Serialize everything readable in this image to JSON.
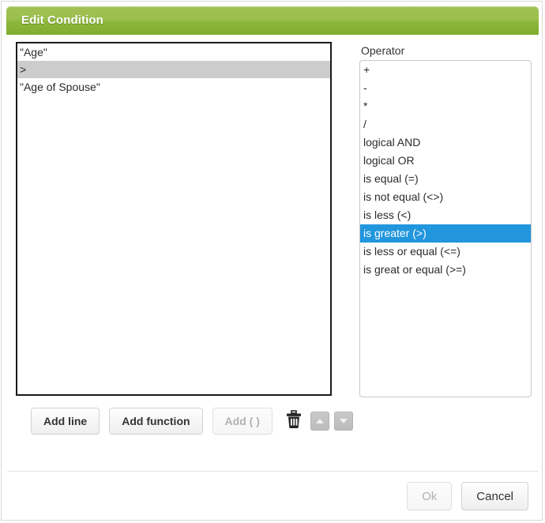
{
  "window": {
    "title": "Edit Condition",
    "accent_green": "#8cb63c",
    "selection_blue": "#2196dd",
    "row_selection_grey": "#cccccc"
  },
  "expression_list": {
    "name": "expression-list",
    "items": [
      {
        "text": "\"Age\"",
        "selected": false
      },
      {
        "text": ">",
        "selected": true
      },
      {
        "text": "\"Age of Spouse\"",
        "selected": false
      }
    ]
  },
  "operator_panel": {
    "label": "Operator",
    "items": [
      {
        "text": "+",
        "selected": false
      },
      {
        "text": "-",
        "selected": false
      },
      {
        "text": "*",
        "selected": false
      },
      {
        "text": "/",
        "selected": false
      },
      {
        "text": "logical AND",
        "selected": false
      },
      {
        "text": "logical OR",
        "selected": false
      },
      {
        "text": "is equal (=)",
        "selected": false
      },
      {
        "text": "is not equal (<>)",
        "selected": false
      },
      {
        "text": "is less (<)",
        "selected": false
      },
      {
        "text": "is greater (>)",
        "selected": true
      },
      {
        "text": "is less or equal (<=)",
        "selected": false
      },
      {
        "text": "is great or equal (>=)",
        "selected": false
      }
    ]
  },
  "toolbar": {
    "add_line_label": "Add line",
    "add_function_label": "Add function",
    "add_parens_label": "Add ( )",
    "add_parens_disabled": true,
    "delete_icon": "trash-icon",
    "move_up_icon": "arrow-up-icon",
    "move_down_icon": "arrow-down-icon"
  },
  "footer": {
    "ok_label": "Ok",
    "ok_disabled": true,
    "cancel_label": "Cancel"
  }
}
